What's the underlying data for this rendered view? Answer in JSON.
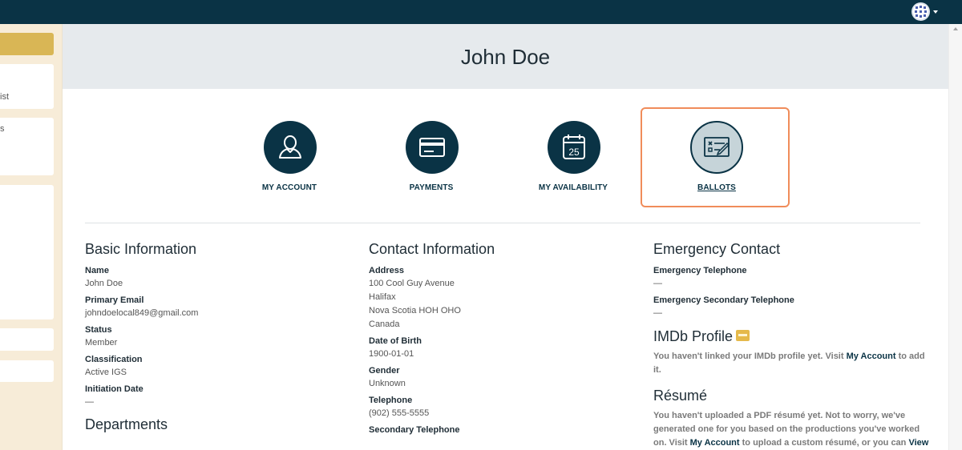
{
  "sidebar": {
    "items": [
      {
        "text": "ist"
      },
      {
        "text": "s"
      }
    ]
  },
  "profile": {
    "name": "John Doe"
  },
  "tiles": [
    {
      "label": "MY ACCOUNT",
      "icon": "user-icon"
    },
    {
      "label": "PAYMENTS",
      "icon": "credit-card-icon"
    },
    {
      "label": "MY AVAILABILITY",
      "icon": "calendar-icon",
      "calendar_day": "25"
    },
    {
      "label": "BALLOTS",
      "icon": "ballot-icon",
      "active": true
    }
  ],
  "basic_info": {
    "title": "Basic Information",
    "name_label": "Name",
    "name_value": "John Doe",
    "email_label": "Primary Email",
    "email_value": "johndoelocal849@gmail.com",
    "status_label": "Status",
    "status_value": "Member",
    "classification_label": "Classification",
    "classification_value": "Active IGS",
    "initiation_label": "Initiation Date",
    "initiation_value": "—"
  },
  "departments": {
    "title": "Departments"
  },
  "contact_info": {
    "title": "Contact Information",
    "address_label": "Address",
    "address_lines": [
      "100 Cool Guy Avenue",
      "Halifax",
      "Nova Scotia HOH OHO",
      "Canada"
    ],
    "dob_label": "Date of Birth",
    "dob_value": "1900-01-01",
    "gender_label": "Gender",
    "gender_value": "Unknown",
    "telephone_label": "Telephone",
    "telephone_value": "(902) 555-5555",
    "secondary_telephone_label": "Secondary Telephone"
  },
  "emergency": {
    "title": "Emergency Contact",
    "phone_label": "Emergency Telephone",
    "phone_value": "—",
    "secondary_label": "Emergency Secondary Telephone",
    "secondary_value": "—"
  },
  "imdb": {
    "title": "IMDb Profile",
    "note_before": "You haven't linked your IMDb profile yet. Visit ",
    "link": "My Account",
    "note_after": " to add it."
  },
  "resume": {
    "title": "Résumé",
    "note_line1": "You haven't uploaded a PDF résumé yet. Not to worry, we've",
    "note_line2": "generated one for you based on the productions you've worked",
    "note_line3_a": "on. Visit ",
    "note_line3_link": "My Account",
    "note_line3_b": " to upload a custom résumé, or you can ",
    "note_line3_link2": "View"
  },
  "colors": {
    "topbar": "#0a3345",
    "sidebar_bg": "#f7ecd8",
    "sidebar_accent": "#d9b655",
    "header_bg": "#e6eaed",
    "icon_circle": "#0a3345",
    "active_border": "#f08c5a",
    "imdb_badge": "#e5b94a"
  }
}
